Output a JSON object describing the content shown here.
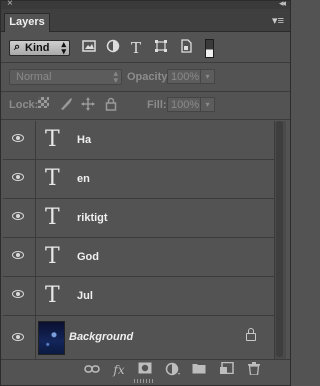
{
  "panel": {
    "title": "Layers",
    "close_glyph": "×",
    "collapse_glyph": "◂◂",
    "menu_glyph": "▾≡"
  },
  "filter": {
    "kind_label": "Kind",
    "search_icon": "search-icon",
    "filter_icons": [
      "image-filter-icon",
      "adjustment-filter-icon",
      "type-filter-icon",
      "shape-filter-icon",
      "smart-object-filter-icon"
    ]
  },
  "blend": {
    "mode": "Normal",
    "opacity_label": "Opacity:",
    "opacity_value": "100%"
  },
  "locks": {
    "lock_label": "Lock:",
    "fill_label": "Fill:",
    "fill_value": "100%"
  },
  "layers": [
    {
      "name": "Ha",
      "type": "text",
      "visible": true
    },
    {
      "name": "en",
      "type": "text",
      "visible": true
    },
    {
      "name": "riktigt",
      "type": "text",
      "visible": true
    },
    {
      "name": "God",
      "type": "text",
      "visible": true
    },
    {
      "name": "Jul",
      "type": "text",
      "visible": true
    },
    {
      "name": "Background",
      "type": "image",
      "visible": true,
      "locked": true
    }
  ],
  "type_glyph": "T",
  "bottom_icons": [
    "link-icon",
    "fx-icon",
    "mask-icon",
    "adjustment-icon",
    "folder-icon",
    "new-layer-icon",
    "trash-icon"
  ],
  "fx_label": "fx"
}
